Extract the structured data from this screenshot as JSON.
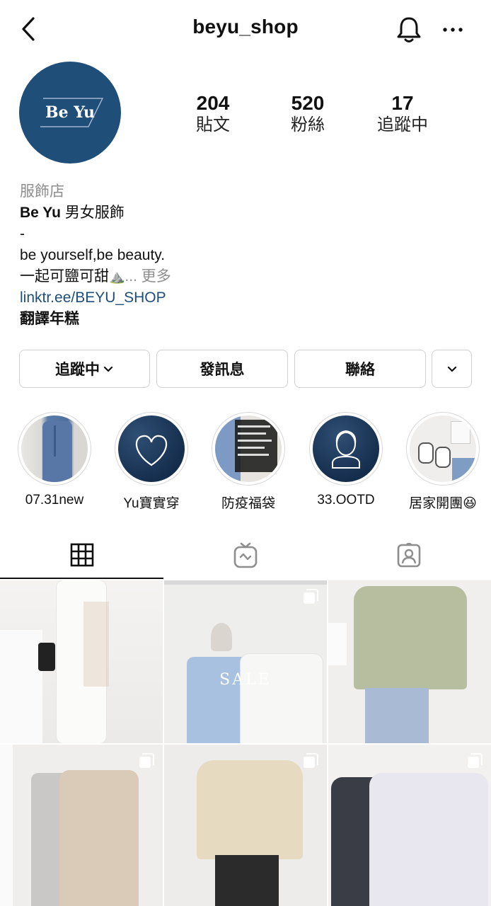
{
  "header": {
    "username": "beyu_shop"
  },
  "profile": {
    "avatar_text": "Be Yu",
    "stats": [
      {
        "value": "204",
        "label": "貼文"
      },
      {
        "value": "520",
        "label": "粉絲"
      },
      {
        "value": "17",
        "label": "追蹤中"
      }
    ],
    "category": "服飾店",
    "name": "Be Yu",
    "name_suffix": " 男女服飾",
    "bio_dash": "-",
    "bio_line1": "be yourself,be beauty.",
    "bio_line2": "一起可鹽可甜",
    "bio_emoji": "⛰️",
    "bio_more_ellipsis": "... ",
    "bio_more": "更多",
    "link": "linktr.ee/BEYU_SHOP",
    "translate": "翻譯年糕"
  },
  "actions": {
    "following": "追蹤中",
    "message": "發訊息",
    "contact": "聯絡"
  },
  "highlights": [
    {
      "label": "07.31new"
    },
    {
      "label": "Yu寶實穿"
    },
    {
      "label": "防疫福袋"
    },
    {
      "label": "33.OOTD"
    },
    {
      "label": "居家開團😆"
    }
  ],
  "posts": [
    {
      "overlay": ""
    },
    {
      "overlay": "SALE"
    },
    {
      "overlay": ""
    },
    {
      "overlay": ""
    },
    {
      "overlay": ""
    },
    {
      "overlay": ""
    }
  ],
  "colors": {
    "avatar_bg": "#1f4e79",
    "link": "#1f4e79",
    "muted": "#8e8e8e"
  }
}
